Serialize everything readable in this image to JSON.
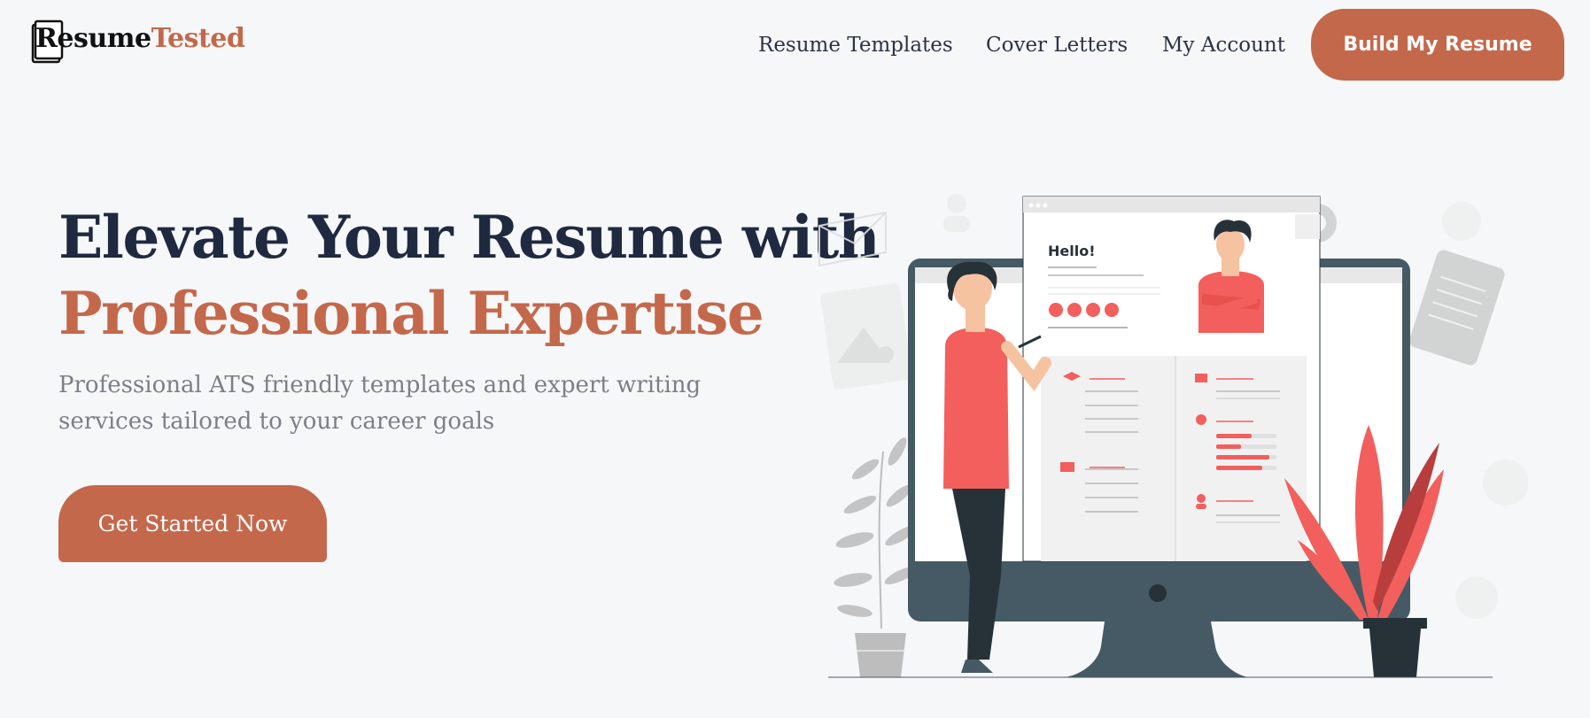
{
  "header": {
    "logo": {
      "part1": "Resume",
      "part2": "Tested",
      "mark_letter": "R"
    },
    "nav": [
      "Resume Templates",
      "Cover Letters",
      "My Account"
    ],
    "cta_label": "Build My Resume"
  },
  "hero": {
    "title_line1": "Elevate Your Resume with",
    "title_line2": "Professional Expertise",
    "subtitle": "Professional ATS friendly templates and expert writing services tailored to your career goals",
    "cta_label": "Get Started Now"
  },
  "illustration": {
    "greeting": "Hello!",
    "social_icons": [
      "facebook-icon",
      "google-plus-icon",
      "instagram-icon",
      "linkedin-icon"
    ]
  },
  "colors": {
    "accent": "#c4684b",
    "heading": "#1f2a40",
    "background": "#f6f7f9",
    "illustration_red": "#f25f5c"
  }
}
